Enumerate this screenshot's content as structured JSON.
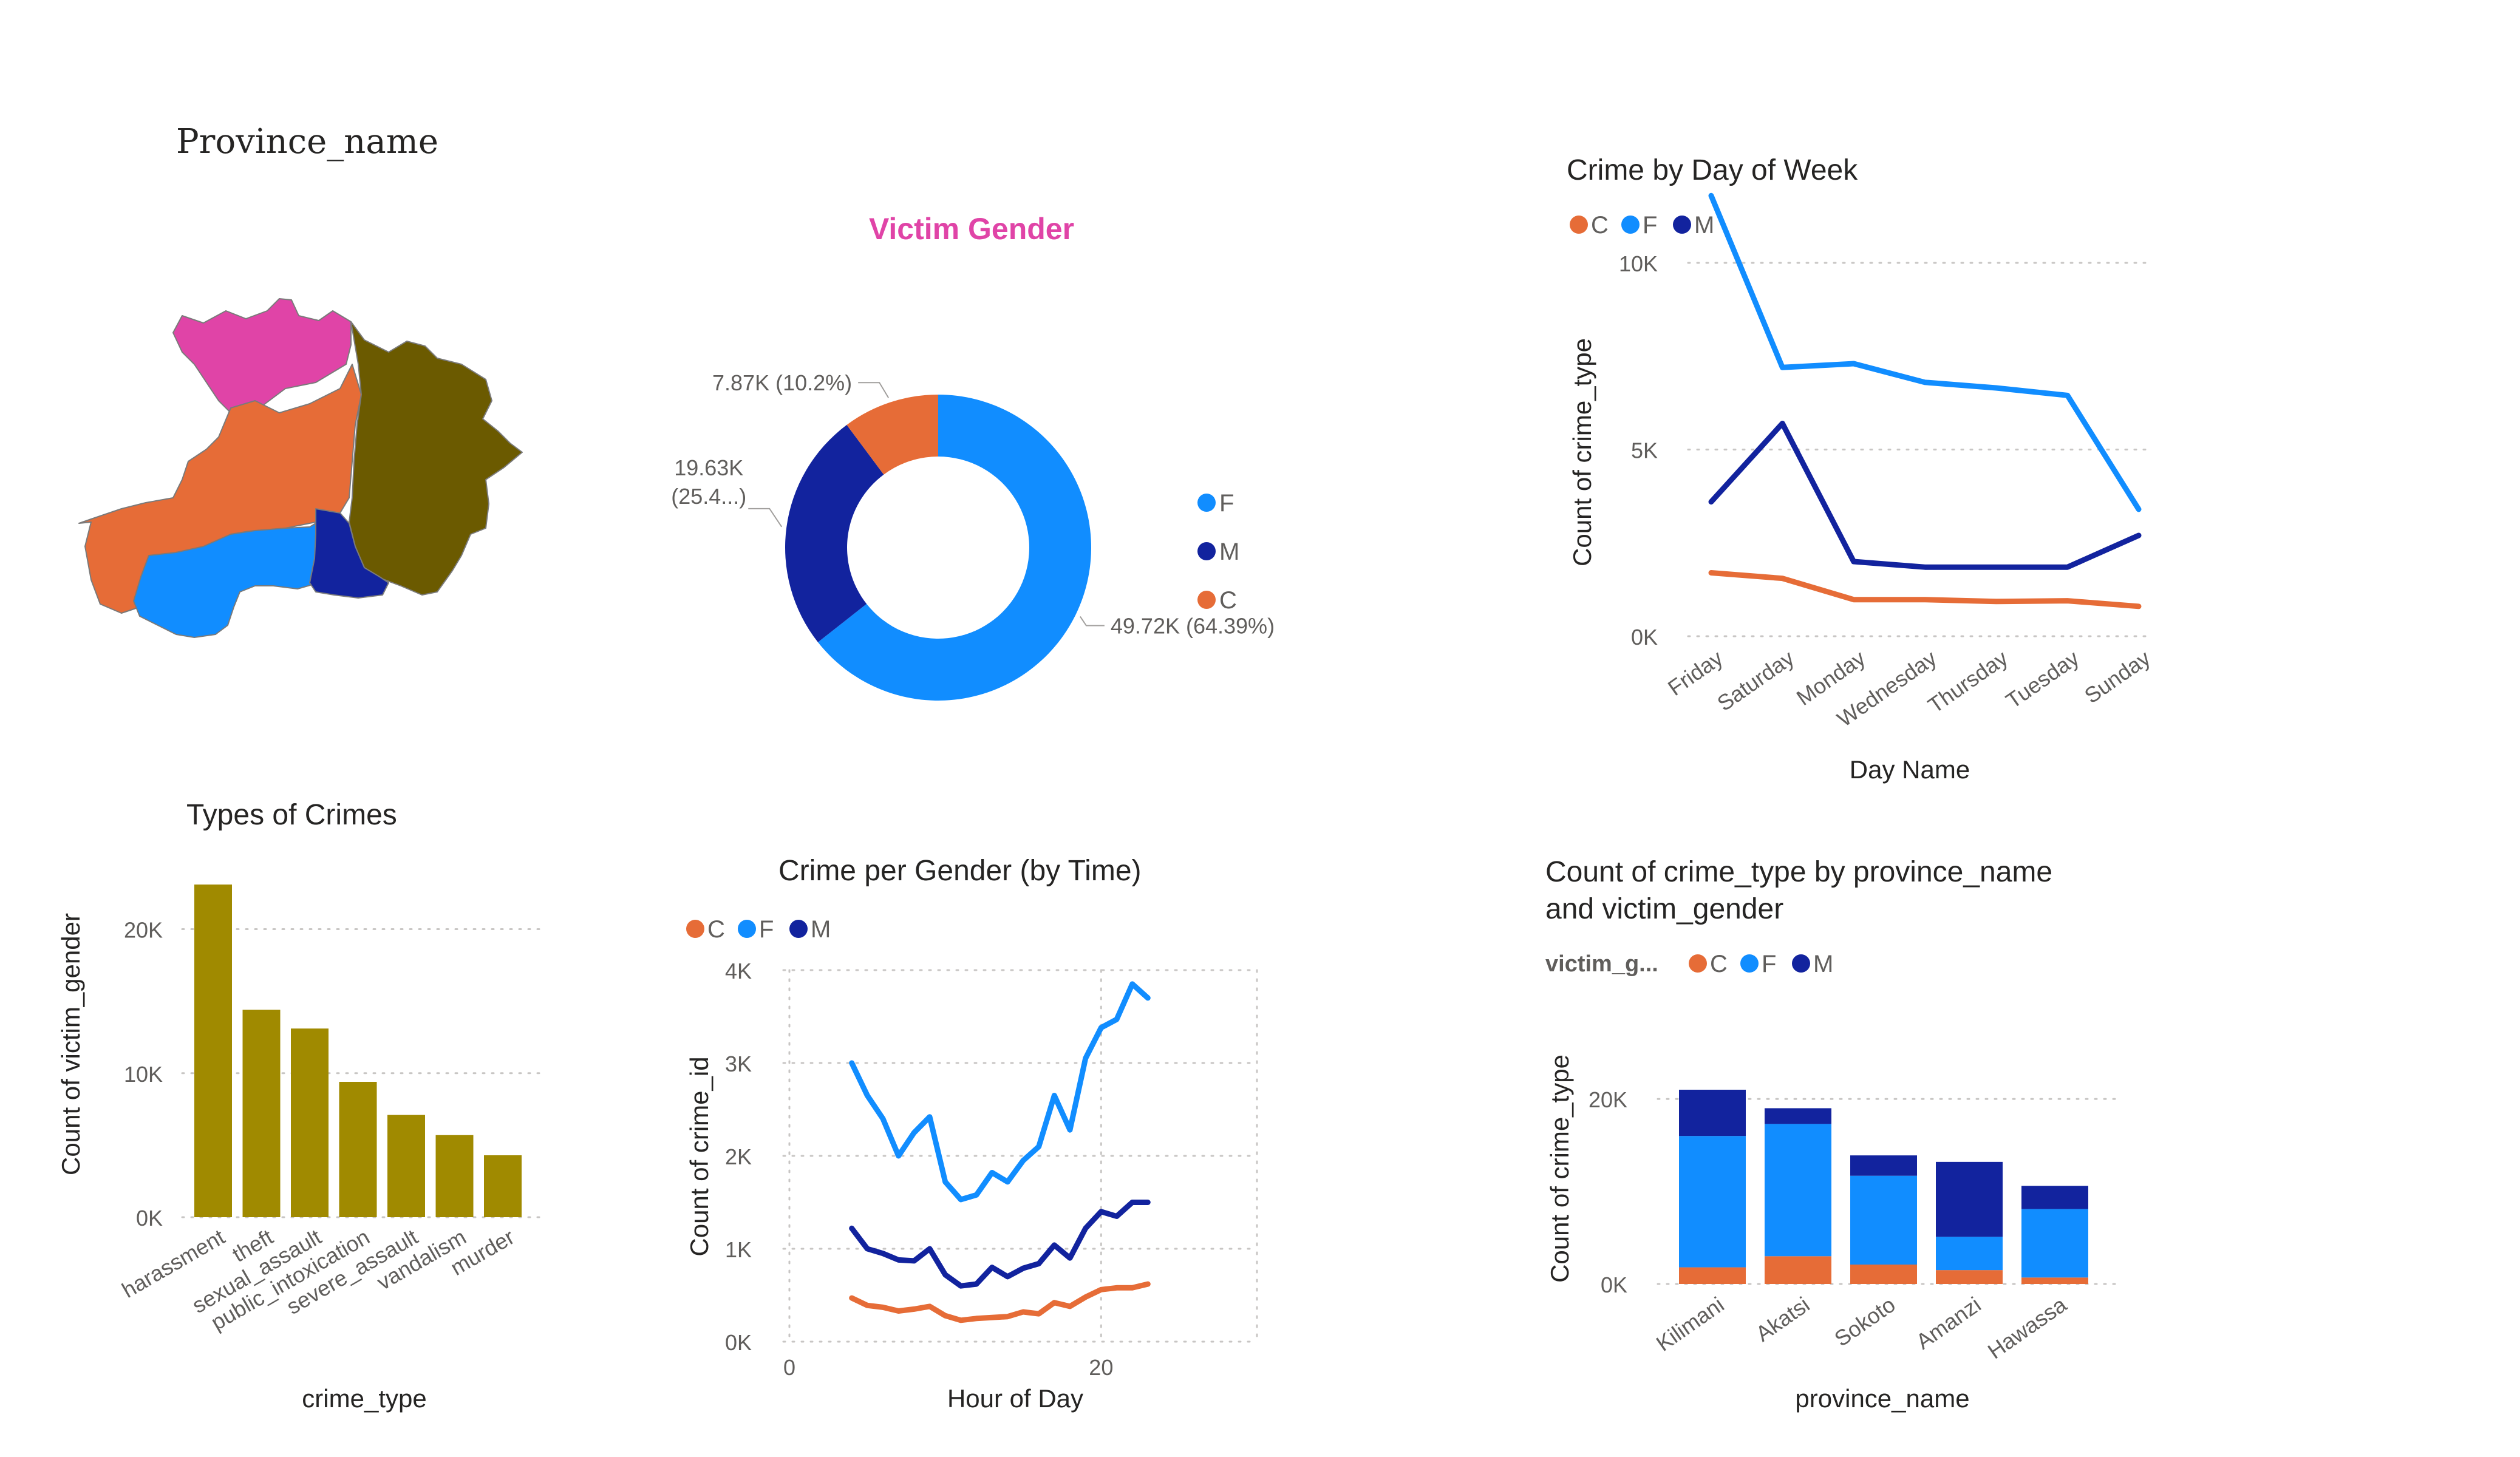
{
  "colors": {
    "C": "#E66C37",
    "F": "#118DFF",
    "M": "#12239E",
    "olive": "#A08A00",
    "pink": "#E044A7",
    "map_brown": "#6B5A00",
    "text": "#252423",
    "axis_text": "#605E5C",
    "grid": "#C8C6C4"
  },
  "map_visual": {
    "title": "Province_name",
    "regions": [
      {
        "name": "north",
        "color_key": "pink",
        "icon": "province-region-shape"
      },
      {
        "name": "center",
        "color_key": "C",
        "icon": "province-region-shape"
      },
      {
        "name": "east",
        "color_key": "map_brown",
        "icon": "province-region-shape"
      },
      {
        "name": "south",
        "color_key": "F",
        "icon": "province-region-shape"
      },
      {
        "name": "southeast",
        "color_key": "M",
        "icon": "province-region-shape"
      }
    ]
  },
  "chart_data": [
    {
      "id": "victim_gender",
      "type": "pie",
      "title": "Victim Gender",
      "legend": [
        "F",
        "M",
        "C"
      ],
      "legend_position": "right",
      "slices": [
        {
          "name": "F",
          "value": 49720,
          "label": "49.72K (64.39%)"
        },
        {
          "name": "M",
          "value": 19630,
          "label": "19.63K",
          "label2": "(25.4...)"
        },
        {
          "name": "C",
          "value": 7870,
          "label": "7.87K (10.2%)"
        }
      ]
    },
    {
      "id": "day_of_week",
      "type": "line",
      "title": "Crime by Day of Week",
      "xlabel": "Day Name",
      "ylabel": "Count of crime_type",
      "legend_position": "top-left",
      "categories": [
        "Friday",
        "Saturday",
        "Monday",
        "Wednesday",
        "Thursday",
        "Tuesday",
        "Sunday"
      ],
      "ylim": [
        0,
        12000
      ],
      "yticks": [
        0,
        5000,
        10000
      ],
      "ytick_labels": [
        "0K",
        "5K",
        "10K"
      ],
      "grid": true,
      "series": [
        {
          "name": "C",
          "values": [
            1700,
            1550,
            980,
            980,
            930,
            950,
            800
          ]
        },
        {
          "name": "F",
          "values": [
            11800,
            7200,
            7300,
            6800,
            6650,
            6450,
            3400
          ]
        },
        {
          "name": "M",
          "values": [
            3600,
            5700,
            2000,
            1850,
            1850,
            1850,
            2700
          ]
        }
      ]
    },
    {
      "id": "types_of_crimes",
      "type": "bar",
      "title": "Types of Crimes",
      "xlabel": "crime_type",
      "ylabel": "Count of victim_gender",
      "categories": [
        "harassment",
        "theft",
        "sexual_assault",
        "public_intoxication",
        "severe_assault",
        "vandalism",
        "murder"
      ],
      "values": [
        23100,
        14400,
        13100,
        9400,
        7100,
        5700,
        4300
      ],
      "ylim": [
        0,
        23100
      ],
      "yticks": [
        0,
        10000,
        20000
      ],
      "ytick_labels": [
        "0K",
        "10K",
        "20K"
      ],
      "grid": true
    },
    {
      "id": "gender_by_time",
      "type": "line",
      "title": "Crime per Gender (by Time)",
      "xlabel": "Hour of Day",
      "ylabel": "Count of crime_id",
      "legend_position": "top-left",
      "xlim": [
        0,
        30
      ],
      "xticks": [
        0,
        20
      ],
      "ylim": [
        0,
        4000
      ],
      "yticks": [
        0,
        1000,
        2000,
        3000,
        4000
      ],
      "ytick_labels": [
        "0K",
        "1K",
        "2K",
        "3K",
        "4K"
      ],
      "grid": true,
      "x": [
        4,
        5,
        6,
        7,
        8,
        9,
        10,
        11,
        12,
        13,
        14,
        15,
        16,
        17,
        18,
        19,
        20,
        21,
        22,
        23
      ],
      "series": [
        {
          "name": "C",
          "values": [
            470,
            390,
            370,
            330,
            350,
            380,
            280,
            230,
            250,
            260,
            270,
            320,
            300,
            420,
            380,
            480,
            560,
            580,
            580,
            620
          ]
        },
        {
          "name": "F",
          "values": [
            3000,
            2650,
            2400,
            2000,
            2250,
            2420,
            1720,
            1530,
            1580,
            1820,
            1720,
            1950,
            2100,
            2650,
            2280,
            3050,
            3380,
            3470,
            3850,
            3700
          ]
        },
        {
          "name": "M",
          "values": [
            1220,
            1000,
            950,
            880,
            870,
            1000,
            720,
            600,
            620,
            800,
            700,
            790,
            840,
            1040,
            900,
            1220,
            1400,
            1350,
            1500,
            1500
          ]
        }
      ]
    },
    {
      "id": "province_gender",
      "type": "bar",
      "stacked": true,
      "title_line1": "Count of crime_type by province_name",
      "title_line2": "and victim_gender",
      "legend_title": "victim_g...",
      "legend_position": "top-left",
      "xlabel": "province_name",
      "ylabel": "Count of crime_type",
      "categories": [
        "Kilimani",
        "Akatsi",
        "Sokoto",
        "Amanzi",
        "Hawassa"
      ],
      "ylim": [
        0,
        21000
      ],
      "yticks": [
        0,
        20000
      ],
      "ytick_labels": [
        "0K",
        "20K"
      ],
      "grid": true,
      "series": [
        {
          "name": "C",
          "values": [
            1800,
            3000,
            2100,
            1500,
            700
          ]
        },
        {
          "name": "F",
          "values": [
            14200,
            14300,
            9600,
            3600,
            7400
          ]
        },
        {
          "name": "M",
          "values": [
            5000,
            1700,
            2200,
            8100,
            2500
          ]
        }
      ]
    }
  ]
}
